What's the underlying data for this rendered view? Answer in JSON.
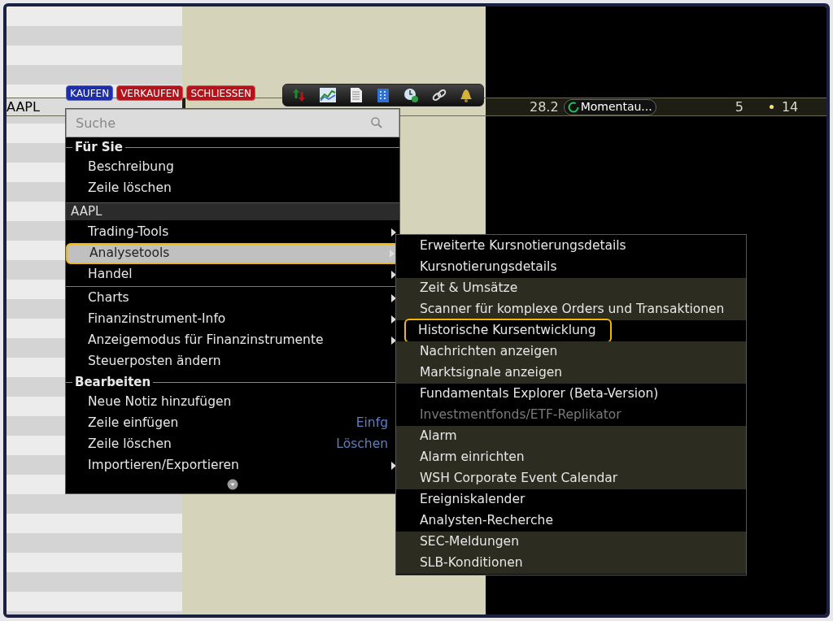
{
  "order_buttons": [
    {
      "label": "KAUFEN",
      "kind": "buy"
    },
    {
      "label": "VERKAUFEN",
      "kind": "sell"
    },
    {
      "label": "SCHLIESSEN",
      "kind": "sell"
    }
  ],
  "quote_row": {
    "symbol": "AAPL",
    "last": "28.2",
    "status": "Momentau...",
    "column_5": "5",
    "column_6": "14"
  },
  "context_menu": {
    "search": {
      "placeholder": "Suche"
    },
    "entries": [
      {
        "kind": "heading",
        "title": "Für Sie"
      },
      {
        "kind": "item",
        "label": "Beschreibung",
        "submenu": false,
        "selected": false
      },
      {
        "kind": "item",
        "label": "Zeile löschen",
        "submenu": false,
        "selected": false
      },
      {
        "kind": "band",
        "title": "AAPL"
      },
      {
        "kind": "item",
        "label": "Trading-Tools",
        "submenu": true,
        "selected": false
      },
      {
        "kind": "item",
        "label": "Analysetools",
        "submenu": true,
        "selected": true
      },
      {
        "kind": "item",
        "label": "Handel",
        "submenu": true,
        "selected": false
      },
      {
        "kind": "divider"
      },
      {
        "kind": "item",
        "label": "Charts",
        "submenu": true,
        "selected": false
      },
      {
        "kind": "item",
        "label": "Finanzinstrument-Info",
        "submenu": true,
        "selected": false
      },
      {
        "kind": "item",
        "label": "Anzeigemodus für Finanzinstrumente",
        "submenu": true,
        "selected": false
      },
      {
        "kind": "item",
        "label": "Steuerposten ändern",
        "submenu": false,
        "selected": false
      },
      {
        "kind": "heading",
        "title": "Bearbeiten"
      },
      {
        "kind": "item",
        "label": "Neue Notiz hinzufügen",
        "submenu": false,
        "selected": false
      },
      {
        "kind": "item",
        "label": "Zeile einfügen",
        "shortcut": "Einfg",
        "submenu": false,
        "selected": false
      },
      {
        "kind": "item",
        "label": "Zeile löschen",
        "shortcut": "Löschen",
        "submenu": false,
        "selected": false
      },
      {
        "kind": "item",
        "label": "Importieren/Exportieren",
        "submenu": true,
        "selected": false
      }
    ]
  },
  "submenu": {
    "groups": [
      {
        "items": [
          {
            "label": "Erweiterte Kursnotierungsdetails",
            "disabled": false,
            "selected": false
          },
          {
            "label": "Kursnotierungsdetails",
            "disabled": false,
            "selected": false
          }
        ]
      },
      {
        "items": [
          {
            "label": "Zeit & Umsätze",
            "disabled": false,
            "selected": false
          },
          {
            "label": "Scanner für komplexe Orders und Transaktionen",
            "disabled": false,
            "selected": false
          }
        ]
      },
      {
        "items": [
          {
            "label": "Historische Kursentwicklung",
            "disabled": false,
            "selected": true
          }
        ]
      },
      {
        "items": [
          {
            "label": "Nachrichten anzeigen",
            "disabled": false,
            "selected": false
          },
          {
            "label": "Marktsignale anzeigen",
            "disabled": false,
            "selected": false
          }
        ]
      },
      {
        "items": [
          {
            "label": "Fundamentals Explorer (Beta-Version)",
            "disabled": false,
            "selected": false
          },
          {
            "label": "Investmentfonds/ETF-Replikator",
            "disabled": true,
            "selected": false
          }
        ]
      },
      {
        "items": [
          {
            "label": "Alarm",
            "disabled": false,
            "selected": false
          },
          {
            "label": "Alarm einrichten",
            "disabled": false,
            "selected": false
          },
          {
            "label": "WSH Corporate Event Calendar",
            "disabled": false,
            "selected": false
          }
        ]
      },
      {
        "items": [
          {
            "label": "Ereigniskalender",
            "disabled": false,
            "selected": false
          },
          {
            "label": "Analysten-Recherche",
            "disabled": false,
            "selected": false
          }
        ]
      },
      {
        "items": [
          {
            "label": "SEC-Meldungen",
            "disabled": false,
            "selected": false
          },
          {
            "label": "SLB-Konditionen",
            "disabled": false,
            "selected": false
          }
        ]
      }
    ]
  }
}
